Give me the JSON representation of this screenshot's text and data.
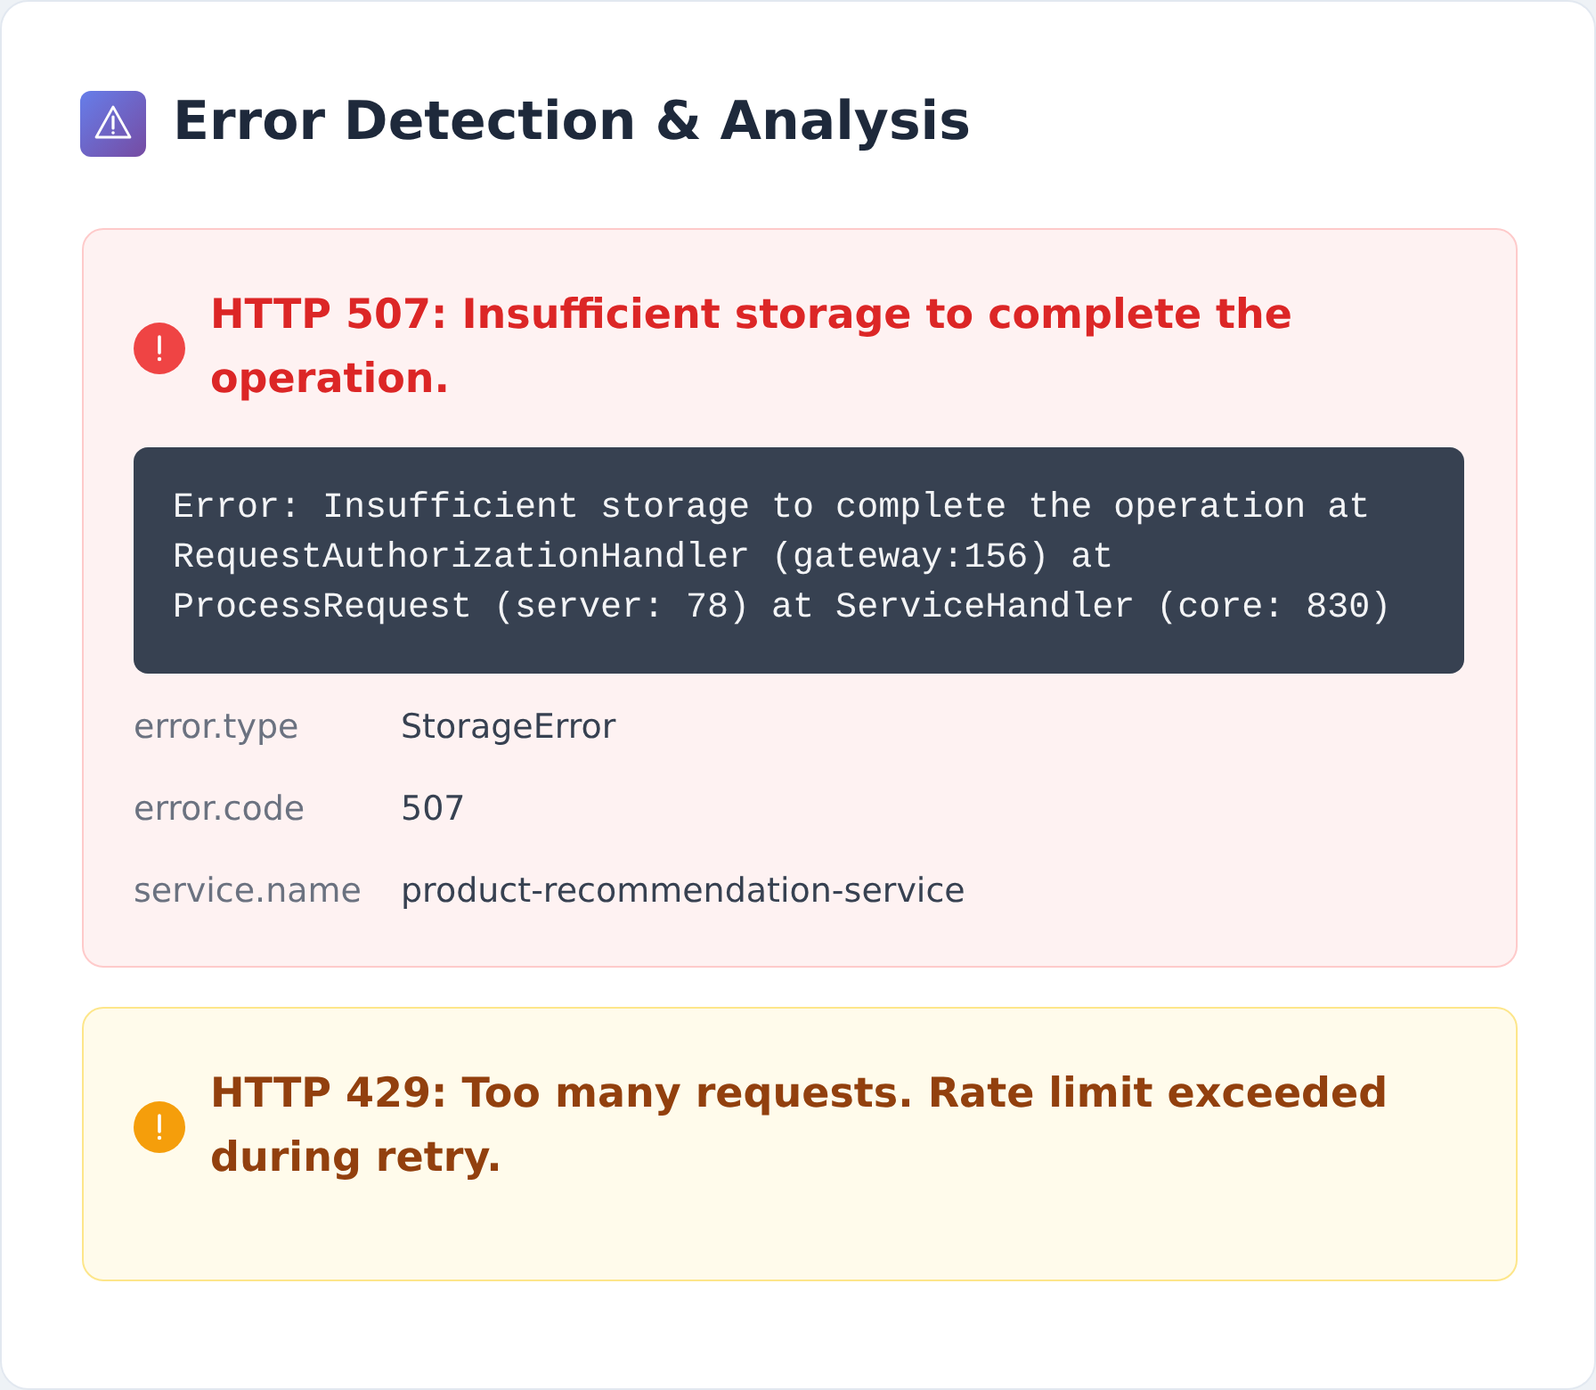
{
  "header": {
    "title": "Error Detection & Analysis"
  },
  "alerts": [
    {
      "kind": "error",
      "title": "HTTP 507: Insufficient storage to complete the operation.",
      "stack_trace": "Error: Insufficient storage to complete the operation at RequestAuthorizationHandler (gateway:156) at ProcessRequest (server: 78) at ServiceHandler (core: 830)",
      "attributes": [
        {
          "key": "error.type",
          "value": "StorageError"
        },
        {
          "key": "error.code",
          "value": "507"
        },
        {
          "key": "service.name",
          "value": "product-recommendation-service"
        }
      ]
    },
    {
      "kind": "warning",
      "title": "HTTP 429: Too many requests. Rate limit exceeded during retry."
    }
  ]
}
